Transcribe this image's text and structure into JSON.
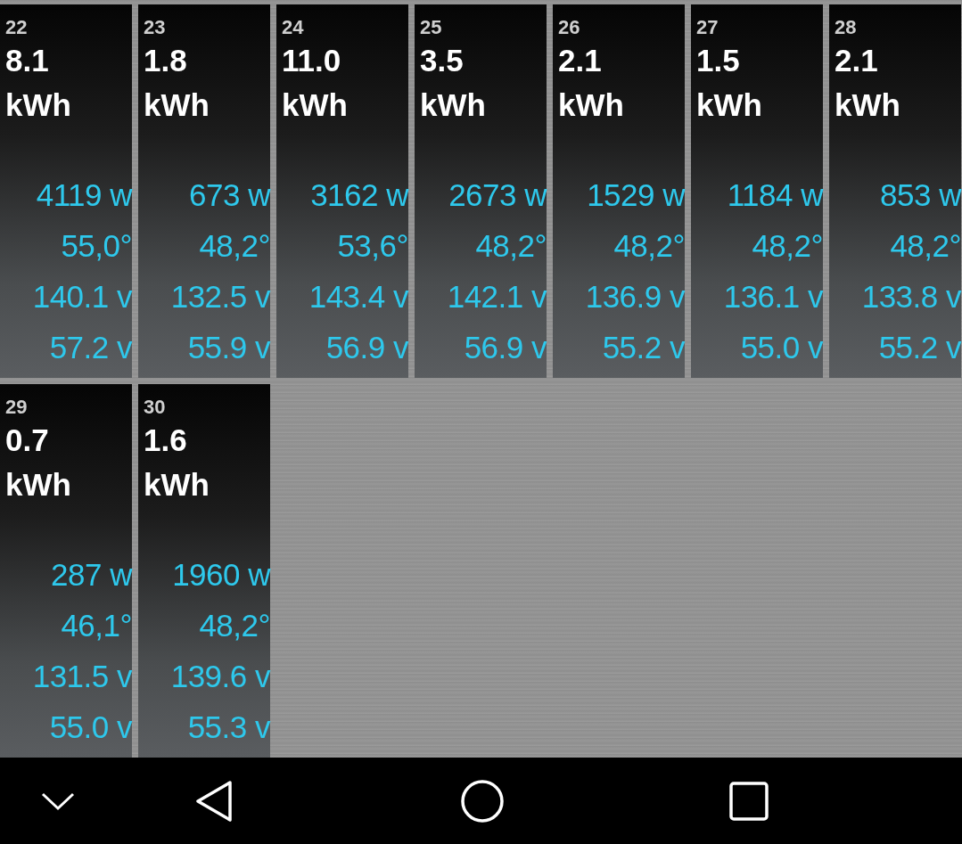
{
  "days": [
    {
      "day": "22",
      "energy": "8.1",
      "unit": "kWh",
      "power": "4119 w",
      "temperature": "55,0°",
      "voltage_1": "140.1 v",
      "voltage_2": "57.2 v"
    },
    {
      "day": "23",
      "energy": "1.8",
      "unit": "kWh",
      "power": "673 w",
      "temperature": "48,2°",
      "voltage_1": "132.5 v",
      "voltage_2": "55.9 v"
    },
    {
      "day": "24",
      "energy": "11.0",
      "unit": "kWh",
      "power": "3162 w",
      "temperature": "53,6°",
      "voltage_1": "143.4 v",
      "voltage_2": "56.9 v"
    },
    {
      "day": "25",
      "energy": "3.5",
      "unit": "kWh",
      "power": "2673 w",
      "temperature": "48,2°",
      "voltage_1": "142.1 v",
      "voltage_2": "56.9 v"
    },
    {
      "day": "26",
      "energy": "2.1",
      "unit": "kWh",
      "power": "1529 w",
      "temperature": "48,2°",
      "voltage_1": "136.9 v",
      "voltage_2": "55.2 v"
    },
    {
      "day": "27",
      "energy": "1.5",
      "unit": "kWh",
      "power": "1184 w",
      "temperature": "48,2°",
      "voltage_1": "136.1 v",
      "voltage_2": "55.0 v"
    },
    {
      "day": "28",
      "energy": "2.1",
      "unit": "kWh",
      "power": "853 w",
      "temperature": "48,2°",
      "voltage_1": "133.8 v",
      "voltage_2": "55.2 v"
    },
    {
      "day": "29",
      "energy": "0.7",
      "unit": "kWh",
      "power": "287 w",
      "temperature": "46,1°",
      "voltage_1": "131.5 v",
      "voltage_2": "55.0 v"
    },
    {
      "day": "30",
      "energy": "1.6",
      "unit": "kWh",
      "power": "1960 w",
      "temperature": "48,2°",
      "voltage_1": "139.6 v",
      "voltage_2": "55.3 v"
    }
  ]
}
